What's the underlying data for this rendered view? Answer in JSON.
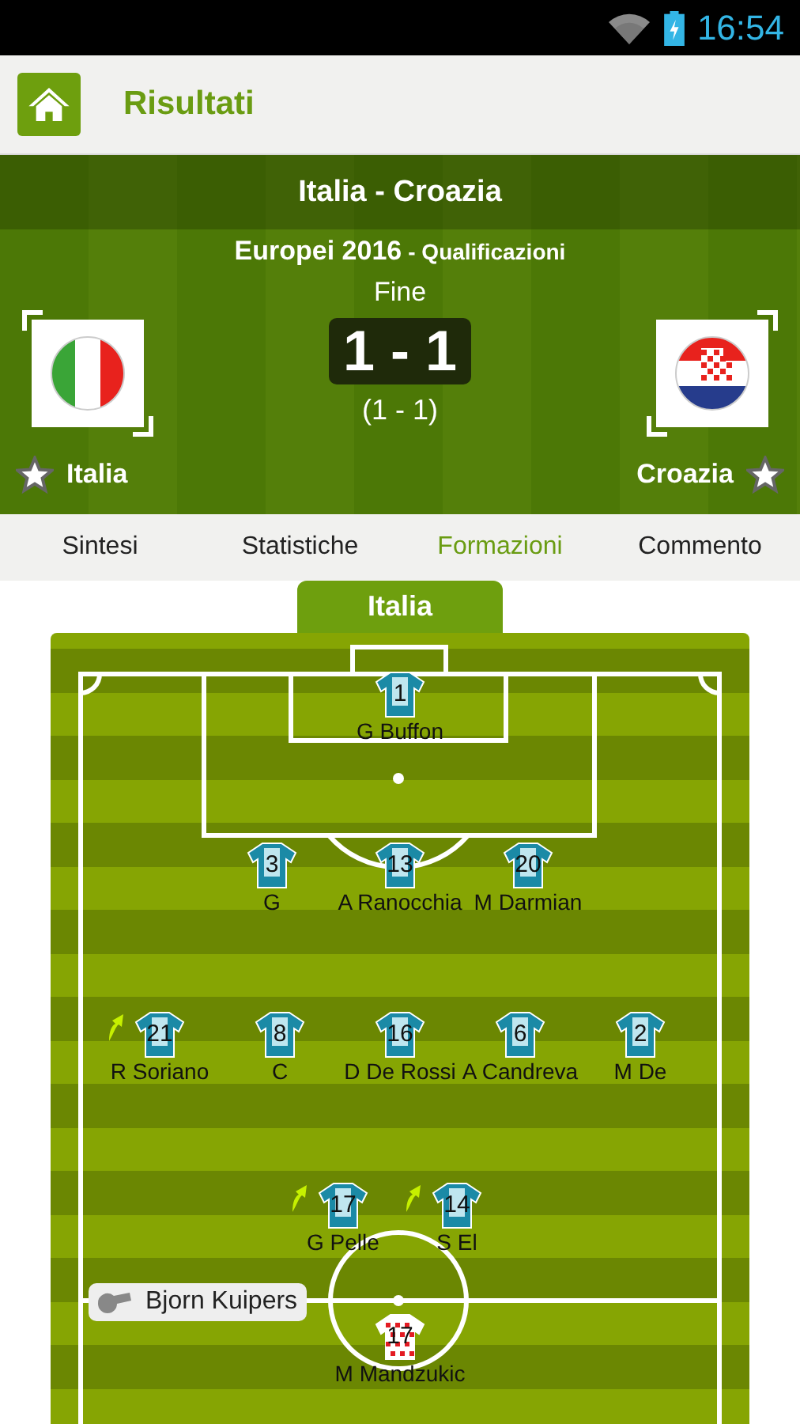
{
  "status_bar": {
    "time": "16:54"
  },
  "action_bar": {
    "title": "Risultati"
  },
  "match": {
    "title": "Italia - Croazia",
    "competition": "Europei 2016",
    "stage": "- Qualificazioni",
    "status": "Fine",
    "score": "1 - 1",
    "halftime": "(1 - 1)",
    "home": {
      "name": "Italia",
      "favorite": false,
      "kind": "italy"
    },
    "away": {
      "name": "Croazia",
      "favorite": false,
      "kind": "croatia"
    }
  },
  "tabs": [
    {
      "label": "Sintesi",
      "selected": false
    },
    {
      "label": "Statistiche",
      "selected": false
    },
    {
      "label": "Formazioni",
      "selected": true
    },
    {
      "label": "Commento",
      "selected": false
    }
  ],
  "lineup": {
    "team_tab": "Italia",
    "referee": "Bjorn Kuipers",
    "rows": [
      {
        "players": [
          {
            "number": "1",
            "name": "G  Buffon",
            "kind": "home",
            "substituted": false
          }
        ]
      },
      {
        "players": [
          {
            "number": "3",
            "name": "G",
            "kind": "home",
            "substituted": false
          },
          {
            "number": "13",
            "name": "A Ranocchia",
            "kind": "home",
            "substituted": false
          },
          {
            "number": "20",
            "name": "M Darmian",
            "kind": "home",
            "substituted": false
          }
        ]
      },
      {
        "players": [
          {
            "number": "21",
            "name": "R Soriano",
            "kind": "home",
            "substituted": true
          },
          {
            "number": "8",
            "name": "C",
            "kind": "home",
            "substituted": false
          },
          {
            "number": "16",
            "name": "D De Rossi",
            "kind": "home",
            "substituted": false
          },
          {
            "number": "6",
            "name": "A Candreva",
            "kind": "home",
            "substituted": false
          },
          {
            "number": "2",
            "name": "M De",
            "kind": "home",
            "substituted": false
          }
        ]
      },
      {
        "players": [
          {
            "number": "17",
            "name": "G Pelle",
            "kind": "home",
            "substituted": true
          },
          {
            "number": "14",
            "name": "S El",
            "kind": "home",
            "substituted": true
          }
        ]
      },
      {
        "players": [
          {
            "number": "17",
            "name": "M Mandzukic",
            "kind": "away",
            "substituted": false
          }
        ]
      }
    ]
  }
}
